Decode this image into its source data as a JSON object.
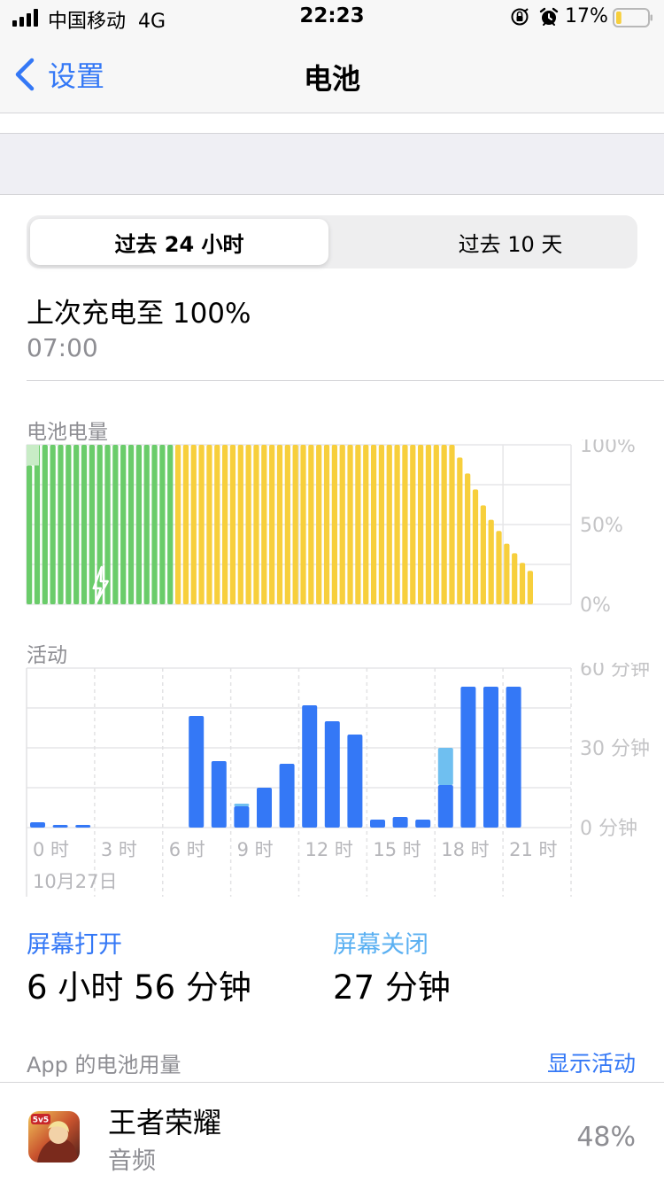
{
  "status_bar": {
    "carrier": "中国移动",
    "network": "4G",
    "time": "22:23",
    "battery_percent": "17%",
    "battery_level": 0.17,
    "battery_color": "#f7cf3c",
    "icons": [
      "signal-icon",
      "orientation-lock-icon",
      "alarm-icon",
      "battery-icon"
    ]
  },
  "nav": {
    "back_label": "设置",
    "title": "电池"
  },
  "segmented": {
    "options": [
      "过去 24 小时",
      "过去 10 天"
    ],
    "selected": "过去 24 小时"
  },
  "last_charge": {
    "title": "上次充电至 100%",
    "time": "07:00"
  },
  "battery_section": {
    "label": "电池电量"
  },
  "activity_section": {
    "label": "活动"
  },
  "chart_data": [
    {
      "type": "bar",
      "title": "电池电量",
      "y_ticks": [
        "100%",
        "50%",
        "0%"
      ],
      "ylim": [
        0,
        100
      ],
      "charging_color": "#6acc6a",
      "normal_color": "#f7cf3c",
      "charging_bar_count": 19,
      "levels": [
        87,
        100,
        100,
        100,
        100,
        100,
        100,
        100,
        100,
        100,
        100,
        100,
        100,
        100,
        100,
        100,
        100,
        100,
        100,
        100,
        100,
        100,
        100,
        100,
        100,
        100,
        100,
        100,
        100,
        100,
        100,
        100,
        100,
        100,
        100,
        100,
        100,
        100,
        100,
        100,
        100,
        100,
        100,
        100,
        100,
        100,
        100,
        100,
        100,
        100,
        100,
        100,
        100,
        100,
        100,
        92,
        82,
        72,
        62,
        53,
        46,
        38,
        32,
        26,
        21
      ]
    },
    {
      "type": "bar",
      "title": "活动",
      "y_ticks": [
        "60 分钟",
        "30 分钟",
        "0 分钟"
      ],
      "ylim": [
        0,
        60
      ],
      "categories": [
        "0时",
        "1时",
        "2时",
        "3时",
        "4时",
        "5时",
        "6时",
        "7时",
        "8时",
        "9时",
        "10时",
        "11时",
        "12时",
        "13时",
        "14时",
        "15时",
        "16时",
        "17时",
        "18时",
        "19时",
        "20时",
        "21时",
        "22时"
      ],
      "x_tick_labels": [
        "0 时",
        "3 时",
        "6 时",
        "9 时",
        "12 时",
        "15 时",
        "18 时",
        "21 时"
      ],
      "date_label": "10月27日",
      "series": [
        {
          "name": "屏幕打开",
          "color": "#3478f6",
          "values": [
            2,
            1,
            1,
            0,
            0,
            0,
            0,
            42,
            25,
            8,
            15,
            24,
            46,
            40,
            35,
            3,
            4,
            3,
            16,
            53,
            53,
            53,
            0
          ]
        },
        {
          "name": "屏幕关闭",
          "color": "#6fbff0",
          "values": [
            0,
            0,
            0,
            0,
            0,
            0,
            0,
            0,
            0,
            1,
            0,
            0,
            0,
            0,
            0,
            0,
            0,
            0,
            14,
            0,
            0,
            0,
            0
          ]
        }
      ]
    }
  ],
  "stats": {
    "screen_on_label": "屏幕打开",
    "screen_on_value": "6 小时 56 分钟",
    "screen_off_label": "屏幕关闭",
    "screen_off_value": "27 分钟"
  },
  "apps_section": {
    "header": "App 的电池用量",
    "show_activity": "显示活动",
    "items": [
      {
        "name": "王者荣耀",
        "subtitle": "音频",
        "percent": "48%"
      }
    ]
  }
}
